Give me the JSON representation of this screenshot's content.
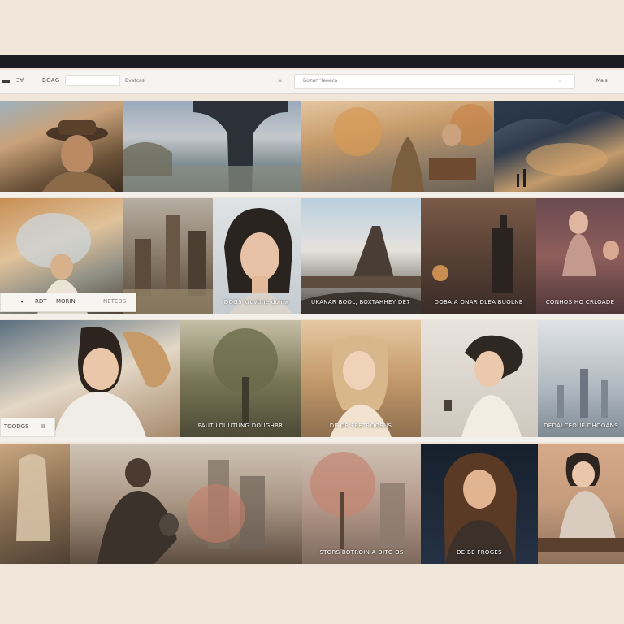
{
  "toolbar": {
    "item1": "Ǝ∀",
    "item2": "BCAG",
    "item3": "Bvatcas",
    "item4": "≡",
    "search_value": "Ботиг Ченесь",
    "item5": "⌕",
    "item6": "Mais"
  },
  "rows": [
    {
      "captions": [
        "",
        "",
        "",
        "",
        ""
      ]
    },
    {
      "captions": [
        "",
        "",
        "DOGS krovtine doinw",
        "UKANAR BOOL, BOXTAHHEY DE7",
        "DOBA A ONAR DLEA BUOLNE",
        "CONHOS HO CRLOADE"
      ]
    },
    {
      "captions": [
        "",
        "",
        "PAUT LOUUTUNG DOUGHBR",
        "DE OR FEETROOSUS",
        "",
        "DEDALCEOUE DHOOANS"
      ]
    },
    {
      "captions": [
        "",
        "",
        "STORS BOTROIN A DITO DS",
        "DE BE FROGES",
        ""
      ]
    }
  ],
  "overlays": {
    "row2_left": {
      "a": "RDT",
      "b": "MORIN",
      "c": "NETEDS"
    },
    "row3_left": {
      "a": "TOODGS",
      "b": "II"
    }
  }
}
